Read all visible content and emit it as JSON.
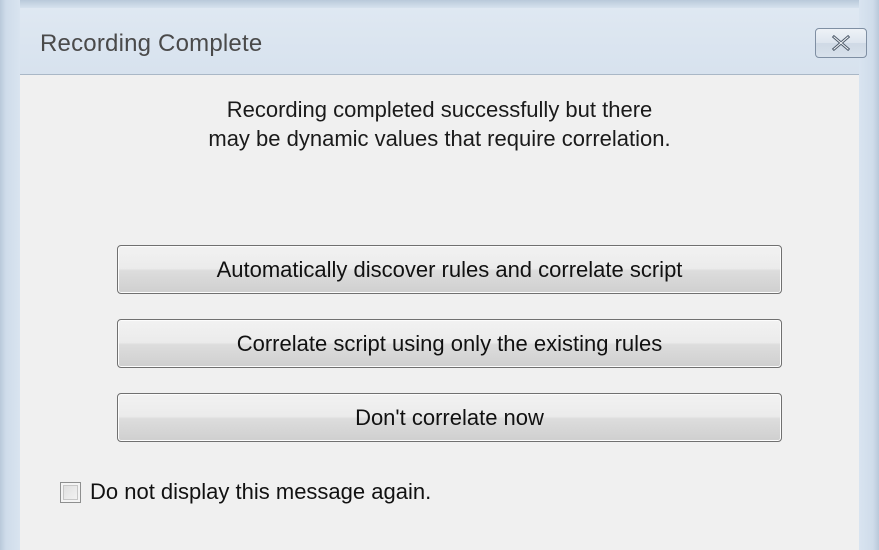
{
  "dialog": {
    "title": "Recording Complete",
    "close_icon": "close-icon",
    "message_line1": "Recording completed successfully but there",
    "message_line2": "may be dynamic values that require correlation.",
    "buttons": [
      {
        "label": "Automatically discover rules and correlate script"
      },
      {
        "label": "Correlate script using only the existing rules"
      },
      {
        "label": "Don't correlate now"
      }
    ],
    "checkbox": {
      "label": "Do not display this message again.",
      "checked": false
    }
  },
  "colors": {
    "titlebar": "#dfe8f2",
    "client_background": "#f0f0f0",
    "title_text": "#4a4a4a"
  }
}
